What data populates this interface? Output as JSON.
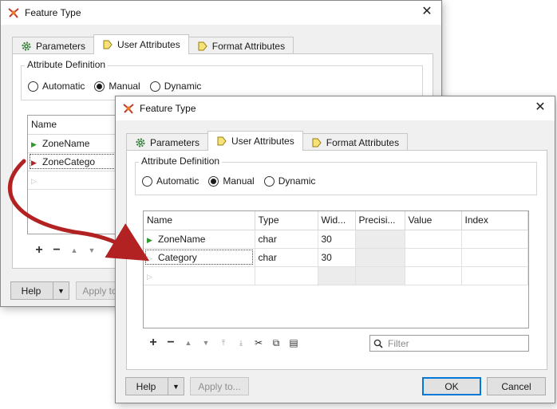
{
  "back_window": {
    "title": "Feature Type",
    "close_glyph": "✕",
    "tabs": [
      {
        "label": "Parameters",
        "icon": "gear-icon"
      },
      {
        "label": "User Attributes",
        "icon": "arrow-tag-icon"
      },
      {
        "label": "Format Attributes",
        "icon": "arrow-tag-icon"
      }
    ],
    "attribute_definition": {
      "label": "Attribute Definition",
      "options": [
        "Automatic",
        "Manual",
        "Dynamic"
      ],
      "selected": "Manual"
    },
    "table": {
      "header": "Name",
      "rows": [
        "ZoneName",
        "ZoneCatego"
      ]
    },
    "buttons": {
      "help": "Help",
      "apply": "Apply to"
    }
  },
  "front_window": {
    "title": "Feature Type",
    "close_glyph": "✕",
    "tabs": [
      {
        "label": "Parameters",
        "icon": "gear-icon"
      },
      {
        "label": "User Attributes",
        "icon": "arrow-tag-icon"
      },
      {
        "label": "Format Attributes",
        "icon": "arrow-tag-icon"
      }
    ],
    "attribute_definition": {
      "label": "Attribute Definition",
      "options": [
        "Automatic",
        "Manual",
        "Dynamic"
      ],
      "selected": "Manual"
    },
    "table": {
      "columns": [
        "Name",
        "Type",
        "Wid...",
        "Precisi...",
        "Value",
        "Index"
      ],
      "rows": [
        {
          "name": "ZoneName",
          "type": "char",
          "width": "30"
        },
        {
          "name": "Category",
          "type": "char",
          "width": "30"
        }
      ]
    },
    "filter": {
      "placeholder": "Filter"
    },
    "buttons": {
      "help": "Help",
      "apply": "Apply to...",
      "ok": "OK",
      "cancel": "Cancel"
    }
  },
  "colors": {
    "accent_red": "#b22222",
    "row_arrow": "#2c9a2c",
    "primary_button_border": "#0078d7"
  }
}
